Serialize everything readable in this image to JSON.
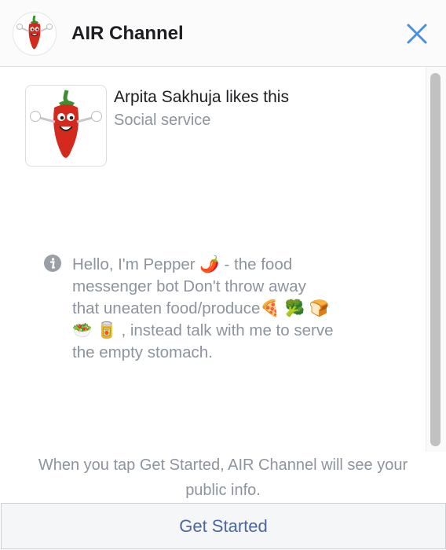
{
  "header": {
    "title": "AIR Channel"
  },
  "page_card": {
    "name": "Arpita Sakhuja likes this",
    "category": "Social service"
  },
  "description": {
    "line1": "Hello, I'm Pepper 🌶️  - the food",
    "line2": "messenger bot Don't throw away",
    "line3": "that uneaten food/produce🍕 🥦 🍞",
    "line4": "🥗 🥫 , instead talk with me to serve",
    "line5": "the empty stomach."
  },
  "footer": {
    "notice_line1": "When you tap Get Started, AIR Channel will see your",
    "notice_line2": "public info.",
    "button_label": "Get Started"
  },
  "icons": {
    "avatar": "chili-pepper-mascot",
    "close": "close-icon",
    "info": "info-icon"
  },
  "colors": {
    "accent": "#4b67a1",
    "close": "#4a90e2",
    "muted": "#8d949e"
  }
}
